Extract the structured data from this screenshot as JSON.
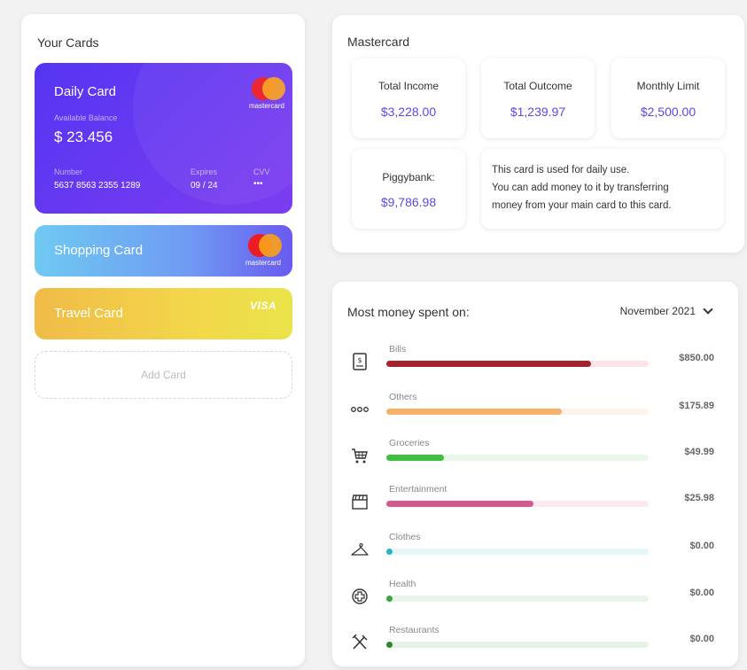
{
  "cards_panel": {
    "title": "Your Cards",
    "daily_card": {
      "name": "Daily Card",
      "balance_label": "Available Balance",
      "balance": "$ 23.456",
      "number_label": "Number",
      "number": "5637 8563 2355 1289",
      "expires_label": "Expires",
      "expires": "09 / 24",
      "cvv_label": "CVV",
      "cvv": "•••",
      "brand_text": "mastercard"
    },
    "shopping_card": {
      "name": "Shopping Card",
      "brand_text": "mastercard"
    },
    "travel_card": {
      "name": "Travel Card",
      "brand_text": "VISA"
    },
    "add_card_label": "Add Card"
  },
  "details_panel": {
    "title": "Mastercard",
    "total_income": {
      "label": "Total Income",
      "value": "$3,228.00"
    },
    "total_outcome": {
      "label": "Total Outcome",
      "value": "$1,239.97"
    },
    "monthly_limit": {
      "label": "Monthly Limit",
      "value": "$2,500.00"
    },
    "piggybank": {
      "label": "Piggybank:",
      "value": "$9,786.98"
    },
    "description_lines": [
      "This card is used for daily use.",
      "You can add money to it by transferring",
      "money from your main card to this card."
    ]
  },
  "spending_panel": {
    "title": "Most money spent on:",
    "month": "November 2021",
    "categories": [
      {
        "name": "Bills",
        "amount": "$850.00",
        "fraction": 0.78,
        "color": "#a3222d",
        "track": "#fbe5e8",
        "icon": "receipt-icon"
      },
      {
        "name": "Others",
        "amount": "$175.89",
        "fraction": 0.67,
        "color": "#f8b168",
        "track": "#fdf3ea",
        "icon": "dots-icon"
      },
      {
        "name": "Groceries",
        "amount": "$49.99",
        "fraction": 0.22,
        "color": "#3fc03f",
        "track": "#e8f8e8",
        "icon": "cart-icon"
      },
      {
        "name": "Entertainment",
        "amount": "$25.98",
        "fraction": 0.56,
        "color": "#d45a8e",
        "track": "#fce8ef",
        "icon": "clapperboard-icon"
      },
      {
        "name": "Clothes",
        "amount": "$0.00",
        "fraction": 0.0,
        "color": "#26b5c6",
        "track": "#e4f6f8",
        "icon": "hanger-icon"
      },
      {
        "name": "Health",
        "amount": "$0.00",
        "fraction": 0.0,
        "color": "#3fa33f",
        "track": "#e8f5e8",
        "icon": "medical-cross-icon"
      },
      {
        "name": "Restaurants",
        "amount": "$0.00",
        "fraction": 0.0,
        "color": "#2a8a2a",
        "track": "#e6f2e6",
        "icon": "utensils-icon"
      }
    ]
  }
}
